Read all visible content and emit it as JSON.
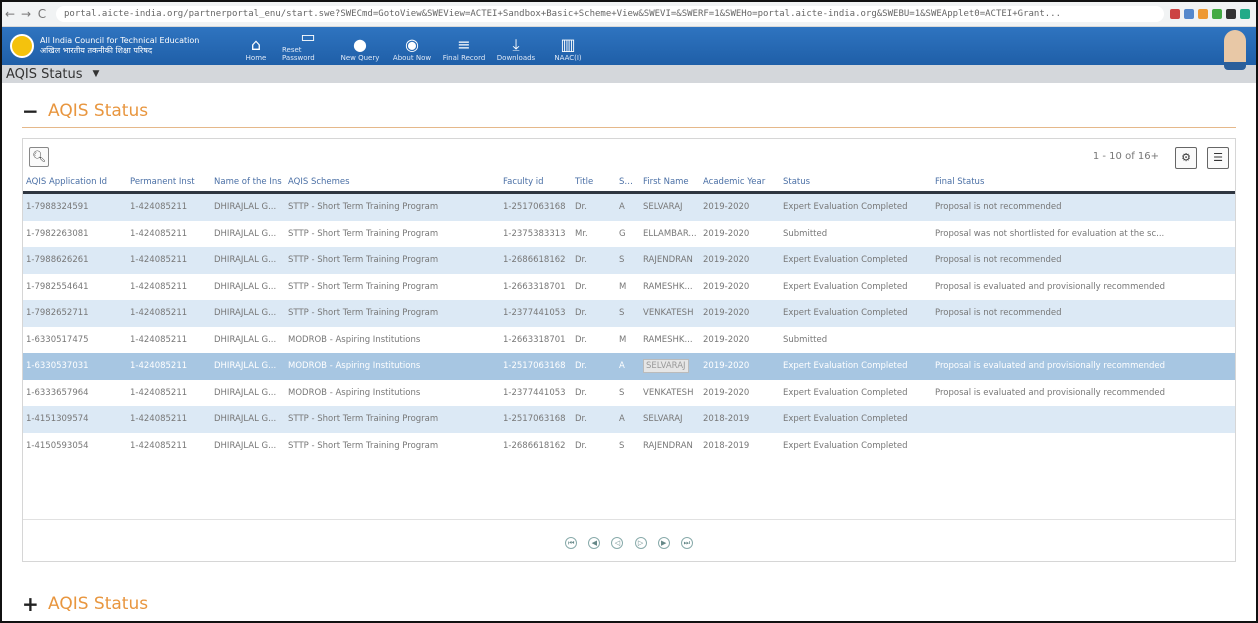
{
  "browser": {
    "url": "portal.aicte-india.org/partnerportal_enu/start.swe?SWECmd=GotoView&SWEView=ACTEI+Sandbox+Basic+Scheme+View&SWEVI=&SWERF=1&SWEHo=portal.aicte-india.org&SWEBU=1&SWEApplet0=ACTEI+Grant..."
  },
  "header": {
    "org_name_en": "All India Council for Technical Education",
    "org_name_hi": "अखिल भारतीय तकनीकी शिक्षा परिषद",
    "nav": [
      {
        "label": "Home",
        "icon": "home-icon",
        "glyph": "⌂"
      },
      {
        "label": "Reset Password",
        "icon": "monitor-icon",
        "glyph": "▭"
      },
      {
        "label": "New Query",
        "icon": "user-icon",
        "glyph": "●"
      },
      {
        "label": "About Now",
        "icon": "info-icon",
        "glyph": "◉"
      },
      {
        "label": "Final Record",
        "icon": "list-icon",
        "glyph": "≡"
      },
      {
        "label": "Downloads",
        "icon": "download-icon",
        "glyph": "⤓"
      },
      {
        "label": "NAAC(I)",
        "icon": "chart-icon",
        "glyph": "▥"
      }
    ]
  },
  "subheader": {
    "title": "AQIS Status"
  },
  "section": {
    "title": "AQIS Status",
    "toggle": "−"
  },
  "grid": {
    "page_info": "1 - 10 of 16+",
    "columns": [
      "AQIS Application Id",
      "Permanent Inst",
      "Name of the Ins",
      "AQIS Schemes",
      "Faculty id",
      "Title",
      "Surn",
      "First Name",
      "Academic Year",
      "Status",
      "Final Status"
    ],
    "rows": [
      [
        "1-7988324591",
        "1-424085211",
        "DHIRAJLAL G...",
        "STTP - Short Term Training Program",
        "1-2517063168",
        "Dr.",
        "A",
        "SELVARAJ",
        "2019-2020",
        "Expert Evaluation Completed",
        "Proposal is not recommended"
      ],
      [
        "1-7982263081",
        "1-424085211",
        "DHIRAJLAL G...",
        "STTP - Short Term Training Program",
        "1-2375383313",
        "Mr.",
        "G",
        "ELLAMBAR...",
        "2019-2020",
        "Submitted",
        "Proposal was not shortlisted for evaluation at the sc..."
      ],
      [
        "1-7988626261",
        "1-424085211",
        "DHIRAJLAL G...",
        "STTP - Short Term Training Program",
        "1-2686618162",
        "Dr.",
        "S",
        "RAJENDRAN",
        "2019-2020",
        "Expert Evaluation Completed",
        "Proposal is not recommended"
      ],
      [
        "1-7982554641",
        "1-424085211",
        "DHIRAJLAL G...",
        "STTP - Short Term Training Program",
        "1-2663318701",
        "Dr.",
        "M",
        "RAMESHK...",
        "2019-2020",
        "Expert Evaluation Completed",
        "Proposal is evaluated and provisionally recommended"
      ],
      [
        "1-7982652711",
        "1-424085211",
        "DHIRAJLAL G...",
        "STTP - Short Term Training Program",
        "1-2377441053",
        "Dr.",
        "S",
        "VENKATESH",
        "2019-2020",
        "Expert Evaluation Completed",
        "Proposal is not recommended"
      ],
      [
        "1-6330517475",
        "1-424085211",
        "DHIRAJLAL G...",
        "MODROB - Aspiring Institutions",
        "1-2663318701",
        "Dr.",
        "M",
        "RAMESHK...",
        "2019-2020",
        "Submitted",
        ""
      ],
      [
        "1-6330537031",
        "1-424085211",
        "DHIRAJLAL G...",
        "MODROB - Aspiring Institutions",
        "1-2517063168",
        "Dr.",
        "A",
        "SELVARAJ",
        "2019-2020",
        "Expert Evaluation Completed",
        "Proposal is evaluated and provisionally recommended"
      ],
      [
        "1-6333657964",
        "1-424085211",
        "DHIRAJLAL G...",
        "MODROB - Aspiring Institutions",
        "1-2377441053",
        "Dr.",
        "S",
        "VENKATESH",
        "2019-2020",
        "Expert Evaluation Completed",
        "Proposal is evaluated and provisionally recommended"
      ],
      [
        "1-4151309574",
        "1-424085211",
        "DHIRAJLAL G...",
        "STTP - Short Term Training Program",
        "1-2517063168",
        "Dr.",
        "A",
        "SELVARAJ",
        "2018-2019",
        "Expert Evaluation Completed",
        ""
      ],
      [
        "1-4150593054",
        "1-424085211",
        "DHIRAJLAL G...",
        "STTP - Short Term Training Program",
        "1-2686618162",
        "Dr.",
        "S",
        "RAJENDRAN",
        "2018-2019",
        "Expert Evaluation Completed",
        ""
      ]
    ],
    "selected_row": 6
  },
  "footer_section": {
    "title": "AQIS Status",
    "toggle": "+"
  }
}
